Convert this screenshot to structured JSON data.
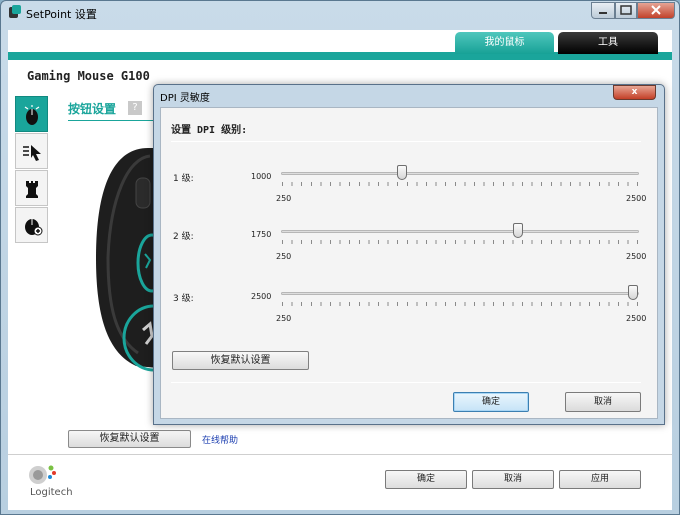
{
  "window": {
    "title": "SetPoint 设置"
  },
  "tabs": {
    "my_mouse": "我的鼠标",
    "tools": "工具"
  },
  "device": {
    "name": "Gaming Mouse G100"
  },
  "section": {
    "title": "按钮设置",
    "help": "?"
  },
  "main": {
    "restore_defaults": "恢复默认设置",
    "online_help": "在线帮助",
    "ok": "确定",
    "cancel": "取消",
    "apply": "应用"
  },
  "brand": {
    "logo_text": "Logitech"
  },
  "dialog": {
    "title": "DPI 灵敏度",
    "close": "x",
    "heading": "设置 DPI 级别:",
    "levels": [
      {
        "label": "1 级:",
        "value": "1000",
        "fraction": 0.3333
      },
      {
        "label": "2 级:",
        "value": "1750",
        "fraction": 0.6667
      },
      {
        "label": "3 级:",
        "value": "2500",
        "fraction": 1.0
      }
    ],
    "min_label": "250",
    "max_label": "2500",
    "restore_defaults": "恢复默认设置",
    "ok": "确定",
    "cancel": "取消"
  },
  "colors": {
    "accent": "#1aa59b",
    "tools_tab": "#111111",
    "link": "#1d3fb0"
  }
}
